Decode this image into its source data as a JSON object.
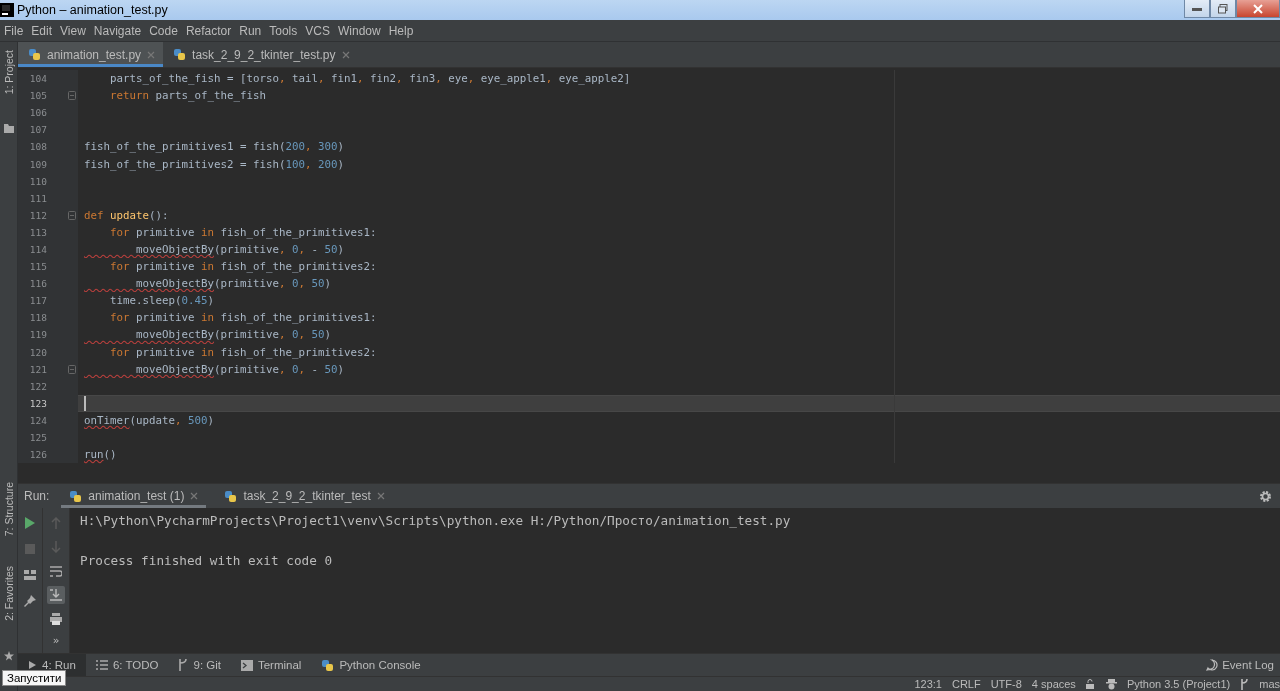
{
  "window": {
    "title": "Python – animation_test.py"
  },
  "menu": [
    "File",
    "Edit",
    "View",
    "Navigate",
    "Code",
    "Refactor",
    "Run",
    "Tools",
    "VCS",
    "Window",
    "Help"
  ],
  "side_tools": {
    "top": [
      "1: Project"
    ],
    "bottom": [
      "7: Structure",
      "2: Favorites"
    ]
  },
  "editor_tabs": [
    {
      "label": "animation_test.py",
      "selected": true
    },
    {
      "label": "task_2_9_2_tkinter_test.py",
      "selected": false
    }
  ],
  "code_lines": [
    {
      "number": "104",
      "current": false,
      "fold": false,
      "tokens": [
        {
          "kind": "text",
          "text": "    parts_of_the_fish = [torso"
        },
        {
          "kind": "comma",
          "text": ","
        },
        {
          "kind": "text",
          "text": " tail"
        },
        {
          "kind": "comma",
          "text": ","
        },
        {
          "kind": "text",
          "text": " fin1"
        },
        {
          "kind": "comma",
          "text": ","
        },
        {
          "kind": "text",
          "text": " fin2"
        },
        {
          "kind": "comma",
          "text": ","
        },
        {
          "kind": "text",
          "text": " fin3"
        },
        {
          "kind": "comma",
          "text": ","
        },
        {
          "kind": "text",
          "text": " eye"
        },
        {
          "kind": "comma",
          "text": ","
        },
        {
          "kind": "text",
          "text": " eye_apple1"
        },
        {
          "kind": "comma",
          "text": ","
        },
        {
          "kind": "text",
          "text": " eye_apple2]"
        }
      ]
    },
    {
      "number": "105",
      "current": false,
      "fold": true,
      "tokens": [
        {
          "kind": "keyword",
          "text": "    return"
        },
        {
          "kind": "text",
          "text": " parts_of_the_fish"
        }
      ]
    },
    {
      "number": "106",
      "current": false,
      "fold": false
    },
    {
      "number": "107",
      "current": false,
      "fold": false
    },
    {
      "number": "108",
      "current": false,
      "fold": false,
      "tokens": [
        {
          "kind": "text",
          "text": "fish_of_the_primitives1 = fish("
        },
        {
          "kind": "number",
          "text": "200"
        },
        {
          "kind": "comma",
          "text": ","
        },
        {
          "kind": "number",
          "text": " 300"
        },
        {
          "kind": "text",
          "text": ")"
        }
      ]
    },
    {
      "number": "109",
      "current": false,
      "fold": false,
      "tokens": [
        {
          "kind": "text",
          "text": "fish_of_the_primitives2 = fish("
        },
        {
          "kind": "number",
          "text": "100"
        },
        {
          "kind": "comma",
          "text": ","
        },
        {
          "kind": "number",
          "text": " 200"
        },
        {
          "kind": "text",
          "text": ")"
        }
      ]
    },
    {
      "number": "110",
      "current": false,
      "fold": false
    },
    {
      "number": "111",
      "current": false,
      "fold": false
    },
    {
      "number": "112",
      "current": false,
      "fold": true,
      "tokens": [
        {
          "kind": "keyword",
          "text": "def "
        },
        {
          "kind": "function",
          "text": "update"
        },
        {
          "kind": "text",
          "text": "():"
        }
      ]
    },
    {
      "number": "113",
      "current": false,
      "fold": false,
      "tokens": [
        {
          "kind": "keyword",
          "text": "    for"
        },
        {
          "kind": "text",
          "text": " primitive "
        },
        {
          "kind": "keyword",
          "text": "in"
        },
        {
          "kind": "text",
          "text": " fish_of_the_primitives1:"
        }
      ]
    },
    {
      "number": "114",
      "current": false,
      "fold": false,
      "tokens": [
        {
          "kind": "squiggle",
          "text": "        moveObjectBy"
        },
        {
          "kind": "text",
          "text": "(primitive"
        },
        {
          "kind": "comma",
          "text": ","
        },
        {
          "kind": "number",
          "text": " 0"
        },
        {
          "kind": "comma",
          "text": ","
        },
        {
          "kind": "text",
          "text": " - "
        },
        {
          "kind": "number",
          "text": "50"
        },
        {
          "kind": "text",
          "text": ")"
        }
      ]
    },
    {
      "number": "115",
      "current": false,
      "fold": false,
      "tokens": [
        {
          "kind": "keyword",
          "text": "    for"
        },
        {
          "kind": "text",
          "text": " primitive "
        },
        {
          "kind": "keyword",
          "text": "in"
        },
        {
          "kind": "text",
          "text": " fish_of_the_primitives2:"
        }
      ]
    },
    {
      "number": "116",
      "current": false,
      "fold": false,
      "tokens": [
        {
          "kind": "squiggle",
          "text": "        moveObjectBy"
        },
        {
          "kind": "text",
          "text": "(primitive"
        },
        {
          "kind": "comma",
          "text": ","
        },
        {
          "kind": "number",
          "text": " 0"
        },
        {
          "kind": "comma",
          "text": ","
        },
        {
          "kind": "number",
          "text": " 50"
        },
        {
          "kind": "text",
          "text": ")"
        }
      ]
    },
    {
      "number": "117",
      "current": false,
      "fold": false,
      "tokens": [
        {
          "kind": "text",
          "text": "    time.sleep("
        },
        {
          "kind": "number",
          "text": "0.45"
        },
        {
          "kind": "text",
          "text": ")"
        }
      ]
    },
    {
      "number": "118",
      "current": false,
      "fold": false,
      "tokens": [
        {
          "kind": "keyword",
          "text": "    for"
        },
        {
          "kind": "text",
          "text": " primitive "
        },
        {
          "kind": "keyword",
          "text": "in"
        },
        {
          "kind": "text",
          "text": " fish_of_the_primitives1:"
        }
      ]
    },
    {
      "number": "119",
      "current": false,
      "fold": false,
      "tokens": [
        {
          "kind": "squiggle",
          "text": "        moveObjectBy"
        },
        {
          "kind": "text",
          "text": "(primitive"
        },
        {
          "kind": "comma",
          "text": ","
        },
        {
          "kind": "number",
          "text": " 0"
        },
        {
          "kind": "comma",
          "text": ","
        },
        {
          "kind": "number",
          "text": " 50"
        },
        {
          "kind": "text",
          "text": ")"
        }
      ]
    },
    {
      "number": "120",
      "current": false,
      "fold": false,
      "tokens": [
        {
          "kind": "keyword",
          "text": "    for"
        },
        {
          "kind": "text",
          "text": " primitive "
        },
        {
          "kind": "keyword",
          "text": "in"
        },
        {
          "kind": "text",
          "text": " fish_of_the_primitives2:"
        }
      ]
    },
    {
      "number": "121",
      "current": false,
      "fold": true,
      "tokens": [
        {
          "kind": "squiggle",
          "text": "        moveObjectBy"
        },
        {
          "kind": "text",
          "text": "(primitive"
        },
        {
          "kind": "comma",
          "text": ","
        },
        {
          "kind": "number",
          "text": " 0"
        },
        {
          "kind": "comma",
          "text": ","
        },
        {
          "kind": "text",
          "text": " - "
        },
        {
          "kind": "number",
          "text": "50"
        },
        {
          "kind": "text",
          "text": ")"
        }
      ]
    },
    {
      "number": "122",
      "current": false,
      "fold": false
    },
    {
      "number": "123",
      "current": true,
      "fold": false
    },
    {
      "number": "124",
      "current": false,
      "fold": false,
      "tokens": [
        {
          "kind": "squiggle",
          "text": "onTimer"
        },
        {
          "kind": "text",
          "text": "(update"
        },
        {
          "kind": "comma",
          "text": ","
        },
        {
          "kind": "number",
          "text": " 500"
        },
        {
          "kind": "text",
          "text": ")"
        }
      ]
    },
    {
      "number": "125",
      "current": false,
      "fold": false
    },
    {
      "number": "126",
      "current": false,
      "fold": false,
      "tokens": [
        {
          "kind": "squiggle",
          "text": "run"
        },
        {
          "kind": "text",
          "text": "()"
        }
      ]
    }
  ],
  "run_panel": {
    "label": "Run:",
    "tabs": [
      {
        "label": "animation_test (1)",
        "selected": true
      },
      {
        "label": "task_2_9_2_tkinter_test",
        "selected": false
      }
    ],
    "output": [
      "H:\\Python\\PycharmProjects\\Project1\\venv\\Scripts\\python.exe H:/Python/Просто/animation_test.py",
      "Process finished with exit code 0"
    ],
    "more": "»"
  },
  "tool_windows": [
    {
      "label": "4: Run",
      "kind": "run",
      "selected": true
    },
    {
      "label": "6: TODO",
      "kind": "list",
      "selected": false
    },
    {
      "label": "9: Git",
      "kind": "git",
      "selected": false
    },
    {
      "label": "Terminal",
      "kind": "terminal",
      "selected": false
    },
    {
      "label": "Python Console",
      "kind": "python",
      "selected": false
    }
  ],
  "event_log": "Event Log",
  "status_bar": {
    "position": "123:1",
    "line_ending": "CRLF",
    "encoding": "UTF-8",
    "indent": "4 spaces",
    "interpreter": "Python 3.5 (Project1)",
    "branch": "mas"
  },
  "tooltip": "Запустити"
}
